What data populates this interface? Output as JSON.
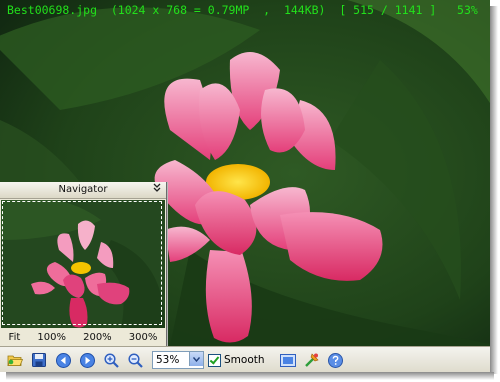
{
  "info_bar": {
    "text": "Best00698.jpg  (1024 x 768 = 0.79MP  ,  144KB)  [ 515 / 1141 ]   53%"
  },
  "navigator": {
    "title": "Navigator",
    "collapse_icon": "double-chevron-down-icon",
    "zoom_links": [
      "Fit",
      "100%",
      "200%",
      "300%"
    ]
  },
  "toolbar": {
    "buttons": [
      "open-folder-icon",
      "save-icon",
      "previous-icon",
      "next-icon",
      "zoom-in-icon",
      "zoom-out-icon"
    ],
    "zoom_value": "53%",
    "smooth_label": "Smooth",
    "smooth_checked": true,
    "extra_buttons": [
      "fullscreen-icon",
      "tools-icon",
      "help-icon"
    ]
  },
  "colors": {
    "info_text": "#22e01b",
    "panel": "#ece9d8",
    "accent_blue": "#2f6fd4"
  }
}
